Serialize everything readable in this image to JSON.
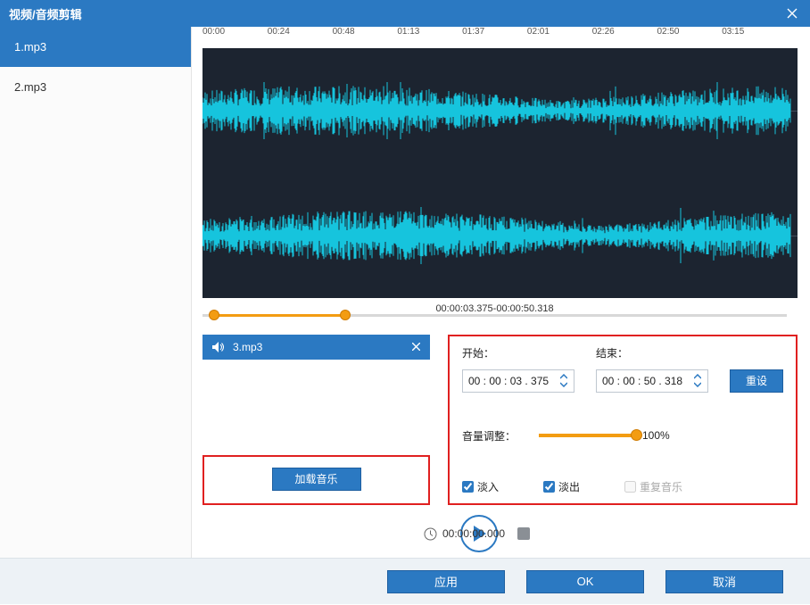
{
  "title": "视频/音频剪辑",
  "sidebar": {
    "items": [
      {
        "label": "1.mp3"
      },
      {
        "label": "2.mp3"
      }
    ],
    "selected": 0
  },
  "ruler": [
    "00:00",
    "00:24",
    "00:48",
    "01:13",
    "01:37",
    "02:01",
    "02:26",
    "02:50",
    "03:15"
  ],
  "range": {
    "text": "00:00:03.375-00:00:50.318",
    "startPct": 2,
    "endPct": 24.5
  },
  "nowplaying": {
    "name": "3.mp3"
  },
  "loadBtn": "加载音乐",
  "panel": {
    "startLabel": "开始：",
    "endLabel": "结束：",
    "startVal": "00 : 00 : 03 . 375",
    "endVal": "00 : 00 : 50 . 318",
    "resetLabel": "重设",
    "volLabel": "音量调整：",
    "volPct": 100,
    "volText": "100%",
    "fadeIn": "淡入",
    "fadeOut": "淡出",
    "repeat": "重复音乐"
  },
  "player": {
    "time": "00:00:00.000"
  },
  "footer": {
    "apply": "应用",
    "ok": "OK",
    "cancel": "取消"
  }
}
